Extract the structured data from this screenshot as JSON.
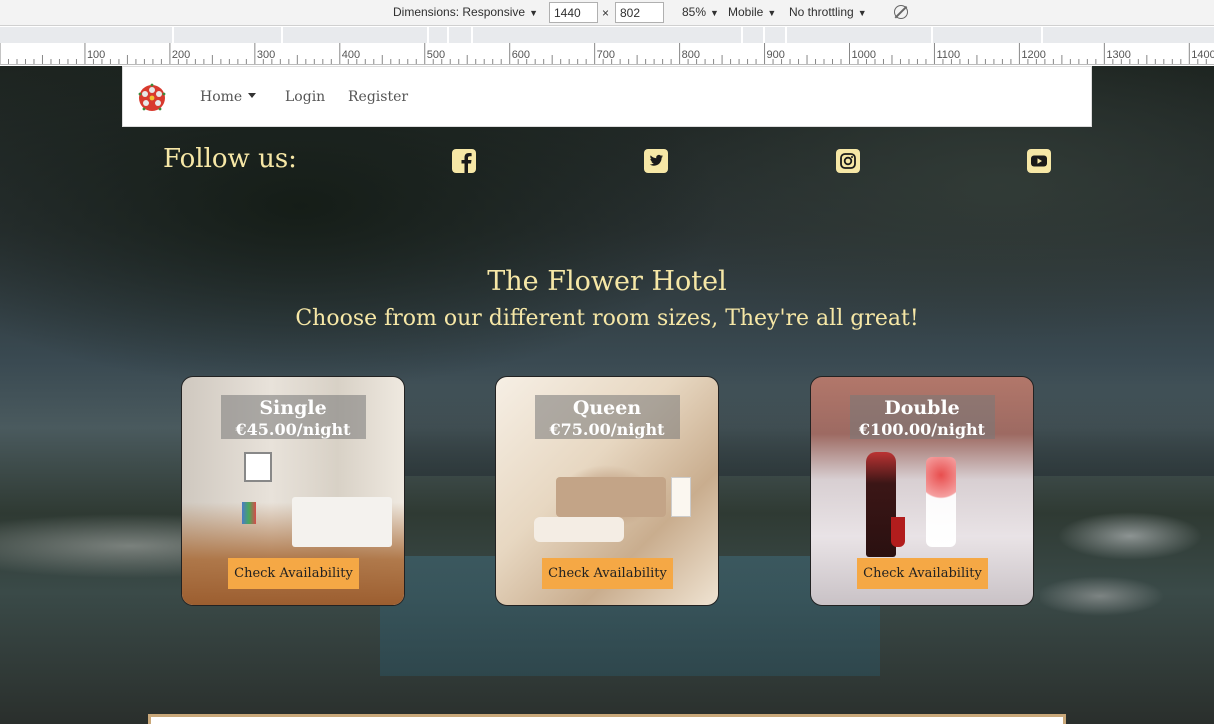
{
  "devtools": {
    "dimensions_label": "Dimensions: Responsive",
    "width_value": "1440",
    "times": "×",
    "height_value": "802",
    "zoom": "85%",
    "device_mode": "Mobile",
    "throttling": "No throttling",
    "ruler_labels": [
      "100",
      "200",
      "300",
      "400",
      "500",
      "600",
      "700",
      "800",
      "900",
      "1000",
      "1100",
      "1200",
      "1300",
      "1400"
    ]
  },
  "navbar": {
    "links": [
      "Home",
      "Login",
      "Register"
    ],
    "logo_icon": "rose-icon"
  },
  "follow": {
    "label": "Follow us:",
    "icons": [
      "facebook-icon",
      "twitter-icon",
      "instagram-icon",
      "youtube-icon"
    ]
  },
  "hero": {
    "title": "The Flower Hotel",
    "subtitle": "Choose from our different room sizes, They're all great!"
  },
  "rooms": [
    {
      "name": "Single",
      "price": "€45.00/night",
      "button": "Check Availability"
    },
    {
      "name": "Queen",
      "price": "€75.00/night",
      "button": "Check Availability"
    },
    {
      "name": "Double",
      "price": "€100.00/night",
      "button": "Check Availability"
    }
  ],
  "colors": {
    "accent_text": "#f6e7a6",
    "button": "#f5a845"
  }
}
